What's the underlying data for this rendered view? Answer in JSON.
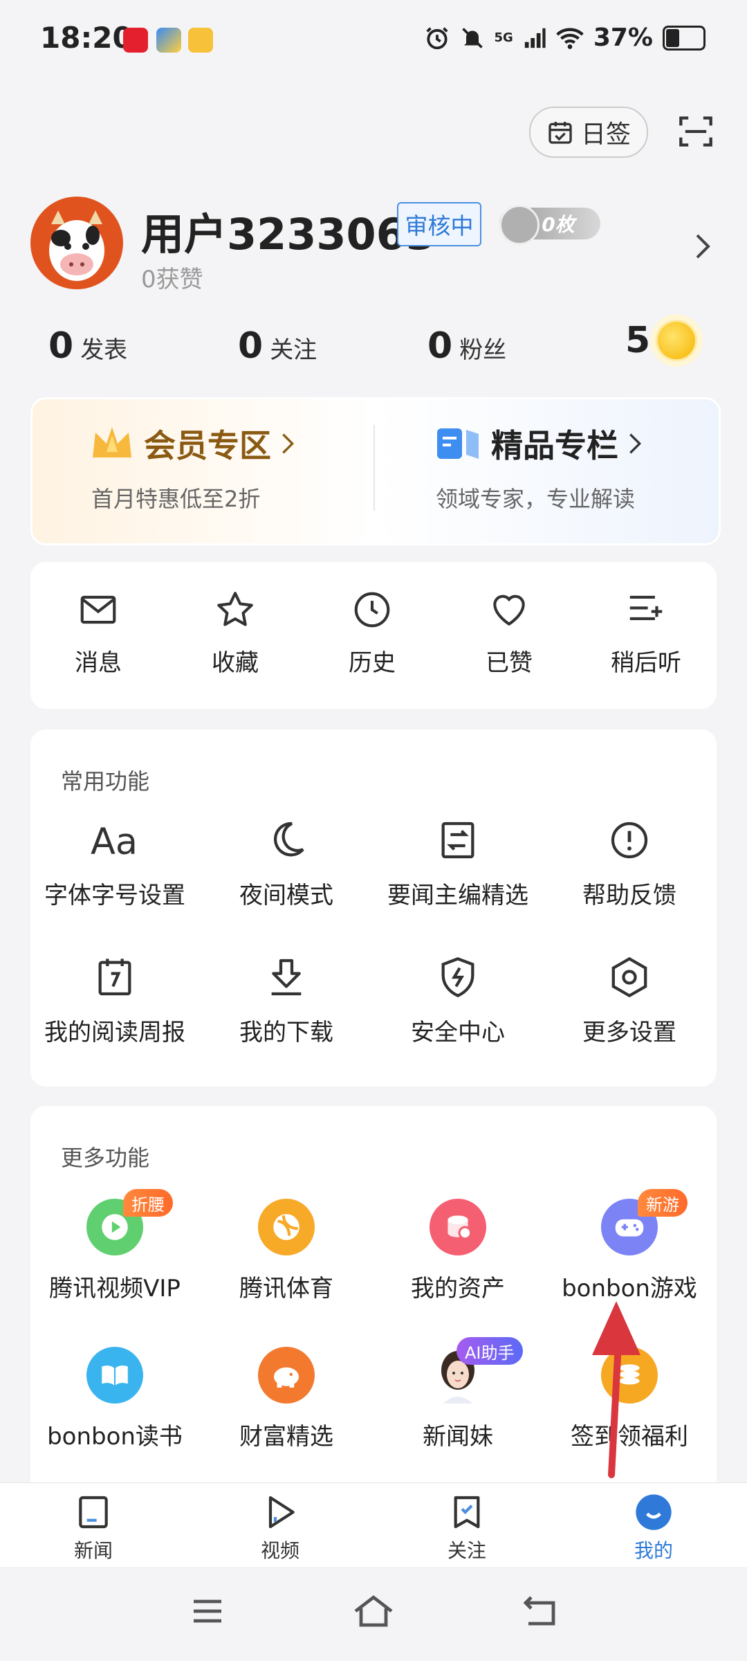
{
  "status_bar": {
    "time": "18:20",
    "network": "5G",
    "battery": "37%",
    "battery_level": 0.37
  },
  "header": {
    "checkin_label": "日签"
  },
  "profile": {
    "username": "用户3233063",
    "review_badge": "审核中",
    "medal_label": "0枚",
    "likes": "0获赞"
  },
  "stats": [
    {
      "value": "0",
      "label": "发表"
    },
    {
      "value": "0",
      "label": "关注"
    },
    {
      "value": "0",
      "label": "粉丝"
    }
  ],
  "coins": "5",
  "promo": {
    "vip_title": "会员专区",
    "vip_sub": "首月特惠低至2折",
    "premium_title": "精品专栏",
    "premium_sub": "领域专家，专业解读"
  },
  "quick_actions": [
    {
      "label": "消息",
      "icon": "mail-icon"
    },
    {
      "label": "收藏",
      "icon": "star-icon"
    },
    {
      "label": "历史",
      "icon": "clock-icon"
    },
    {
      "label": "已赞",
      "icon": "heart-icon"
    },
    {
      "label": "稍后听",
      "icon": "listen-later-icon"
    }
  ],
  "common_features": {
    "title": "常用功能",
    "items": [
      {
        "label": "字体字号设置",
        "icon": "font-icon"
      },
      {
        "label": "夜间模式",
        "icon": "moon-icon"
      },
      {
        "label": "要闻主编精选",
        "icon": "editor-pick-icon"
      },
      {
        "label": "帮助反馈",
        "icon": "help-icon"
      },
      {
        "label": "我的阅读周报",
        "icon": "calendar-icon"
      },
      {
        "label": "我的下载",
        "icon": "download-icon"
      },
      {
        "label": "安全中心",
        "icon": "shield-icon"
      },
      {
        "label": "更多设置",
        "icon": "settings-icon"
      }
    ]
  },
  "more_features": {
    "title": "更多功能",
    "items": [
      {
        "label": "腾讯视频VIP",
        "icon": "video-vip-icon",
        "badge": "折腰",
        "color": "#5fcf6f"
      },
      {
        "label": "腾讯体育",
        "icon": "sports-icon",
        "badge": "",
        "color": "#f7a928"
      },
      {
        "label": "我的资产",
        "icon": "assets-icon",
        "badge": "",
        "color": "#f45f72"
      },
      {
        "label": "bonbon游戏",
        "icon": "game-icon",
        "badge": "新游",
        "color": "#7b83f5"
      },
      {
        "label": "bonbon读书",
        "icon": "book-icon",
        "badge": "",
        "color": "#3ab4ee"
      },
      {
        "label": "财富精选",
        "icon": "piggy-bank-icon",
        "badge": "",
        "color": "#f3792f"
      },
      {
        "label": "新闻妹",
        "icon": "news-girl-avatar",
        "badge": "AI助手",
        "color": "#ffffff"
      },
      {
        "label": "签到领福利",
        "icon": "coins-icon",
        "badge": "",
        "color": "#f6a823"
      }
    ]
  },
  "tabs": [
    {
      "label": "新闻",
      "icon": "news-tab-icon",
      "active": false
    },
    {
      "label": "视频",
      "icon": "video-tab-icon",
      "active": false
    },
    {
      "label": "关注",
      "icon": "follow-tab-icon",
      "active": false
    },
    {
      "label": "我的",
      "icon": "me-tab-icon",
      "active": true
    }
  ],
  "colors": {
    "accent": "#2f7ad8",
    "vip_gold": "#8a5a12",
    "annotation_arrow": "#d9363e"
  }
}
